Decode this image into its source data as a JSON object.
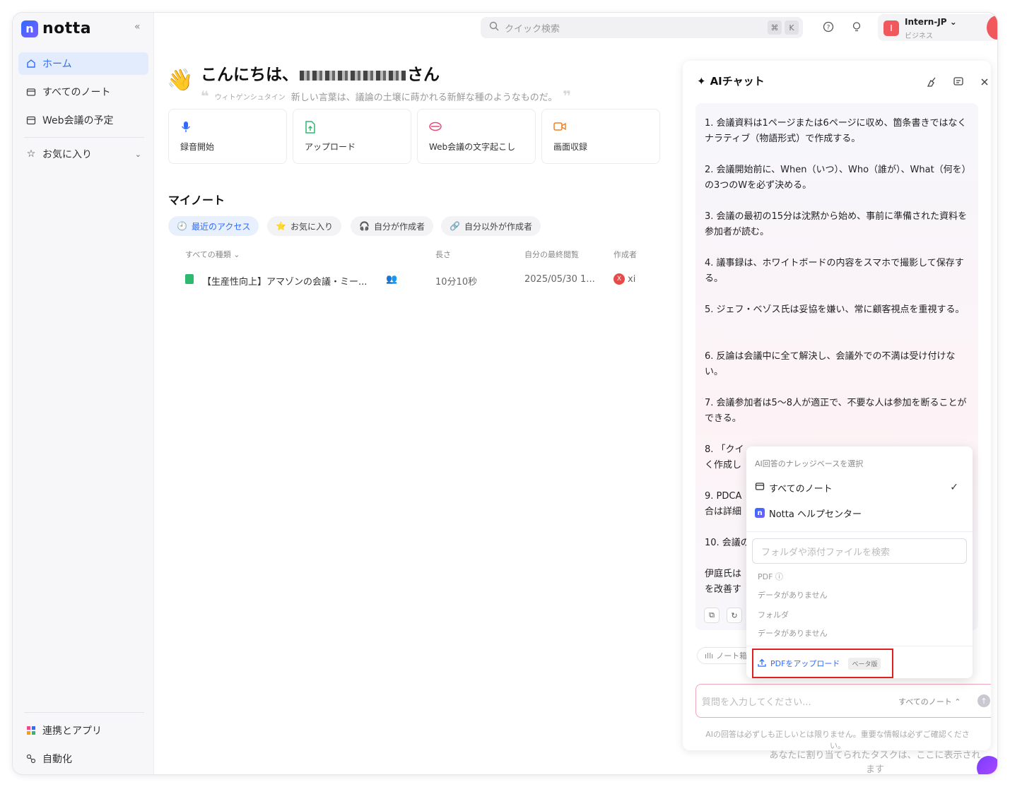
{
  "app": {
    "logo_text": "notta",
    "logo_letter": "n"
  },
  "sidebar": {
    "items": [
      {
        "label": "ホーム"
      },
      {
        "label": "すべてのノート"
      },
      {
        "label": "Web会議の予定"
      },
      {
        "label": "お気に入り"
      }
    ],
    "bottom": [
      {
        "label": "連携とアプリ"
      },
      {
        "label": "自動化"
      }
    ]
  },
  "topbar": {
    "search_placeholder": "クイック検索",
    "kbd1": "⌘",
    "kbd2": "K",
    "user_name": "Intern-JP",
    "user_plan": "ビジネス",
    "user_initial": "I"
  },
  "main": {
    "greeting_prefix": "こんにちは、",
    "greeting_suffix": "さん",
    "quote_author": "ウィトゲンシュタイン",
    "quote_text": "新しい言葉は、議論の土壌に蒔かれる新鮮な種のようなものだ。",
    "cards": [
      {
        "label": "録音開始"
      },
      {
        "label": "アップロード"
      },
      {
        "label": "Web会議の文字起こし"
      },
      {
        "label": "画面収録"
      }
    ],
    "section_title": "マイノート",
    "filters": [
      {
        "label": "最近のアクセス"
      },
      {
        "label": "お気に入り"
      },
      {
        "label": "自分が作成者"
      },
      {
        "label": "自分以外が作成者"
      }
    ],
    "table": {
      "headers": [
        "すべての種類",
        "長さ",
        "自分の最終閲覧",
        "作成者"
      ],
      "rows": [
        {
          "title": "【生産性向上】アマゾンの会議・ミー...",
          "length": "10分10秒",
          "viewed": "2025/05/30 1...",
          "creator_initial": "X",
          "creator": "xi"
        }
      ]
    }
  },
  "ai_chat": {
    "title": "AIチャット",
    "items": [
      "1. 会議資料は1ページまたは6ページに収め、箇条書きではなくナラティブ（物語形式）で作成する。",
      "2. 会議開始前に、When（いつ）、Who（誰が）、What（何を）の3つのWを必ず決める。",
      "3. 会議の最初の15分は沈黙から始め、事前に準備された資料を参加者が読む。",
      "4. 議事録は、ホワイトボードの内容をスマホで撮影して保存する。",
      "5. ジェフ・ベゾス氏は妥協を嫌い、常に顧客視点を重視する。",
      "6. 反論は会議中に全て解決し、会議外での不満は受け付けない。",
      "7. 会議参加者は5〜8人が適正で、不要な人は参加を断ることができる。",
      "8. 「クイ",
      "く作成し",
      "9. PDCA",
      "合は詳細",
      "10. 会議の",
      "伊庭氏は",
      "を改善す"
    ],
    "note_chip": "ノート箱",
    "ask_placeholder": "質問を入力してください...",
    "ask_scope": "すべてのノート ⌃",
    "disclaimer": "AIの回答は必ずしも正しいとは限りません。重要な情報は必ずご確認ください。"
  },
  "popover": {
    "heading": "AI回答のナレッジベースを選択",
    "options": [
      {
        "label": "すべてのノート",
        "checked": true
      },
      {
        "label": "Notta ヘルプセンター",
        "checked": false
      }
    ],
    "search_placeholder": "フォルダや添付ファイルを検索",
    "pdf_label": "PDF ⓘ",
    "pdf_empty": "データがありません",
    "folder_label": "フォルダ",
    "folder_empty": "データがありません",
    "upload_label": "PDFをアップロード",
    "beta": "ベータ版"
  },
  "task_text": "あなたに割り当てられたタスクは、ここに表示されます"
}
